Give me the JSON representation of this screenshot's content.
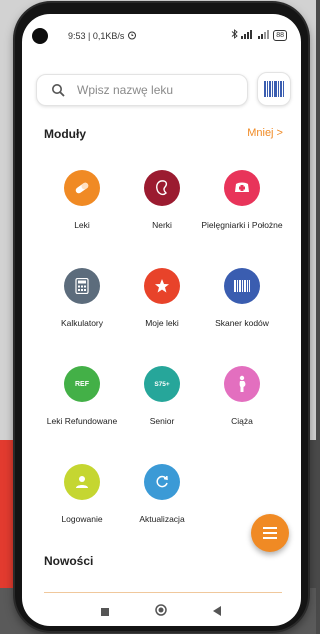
{
  "status_bar": {
    "left_text": "9:53 | 0,1KB/s",
    "battery": "88"
  },
  "search": {
    "placeholder": "Wpisz nazwę leku"
  },
  "modules_section": {
    "title": "Moduły",
    "toggle_label": "Mniej >"
  },
  "modules": [
    {
      "label": "Leki",
      "icon": "pill-icon",
      "color": "#f08a24"
    },
    {
      "label": "Nerki",
      "icon": "kidney-icon",
      "color": "#9b1b30"
    },
    {
      "label": "Pielęgniarki i Położne",
      "icon": "nurse-cap-icon",
      "color": "#e8345a"
    },
    {
      "label": "Kalkulatory",
      "icon": "calculator-icon",
      "color": "#5c6c7c"
    },
    {
      "label": "Moje leki",
      "icon": "star-icon",
      "color": "#e8432a"
    },
    {
      "label": "Skaner kodów",
      "icon": "barcode-icon",
      "color": "#3a5db0"
    },
    {
      "label": "Leki Refundowane",
      "icon": "ref-badge-icon",
      "color": "#43b047",
      "icon_text": "REF"
    },
    {
      "label": "Senior",
      "icon": "s75-badge-icon",
      "color": "#26a69a",
      "icon_text": "S75+"
    },
    {
      "label": "Ciąża",
      "icon": "pregnancy-icon",
      "color": "#e36fbf"
    },
    {
      "label": "Logowanie",
      "icon": "user-icon",
      "color": "#c5d631"
    },
    {
      "label": "Aktualizacja",
      "icon": "refresh-icon",
      "color": "#3b9ad6"
    }
  ],
  "news_section": {
    "title": "Nowości"
  },
  "colors": {
    "accent": "#f08a24"
  }
}
